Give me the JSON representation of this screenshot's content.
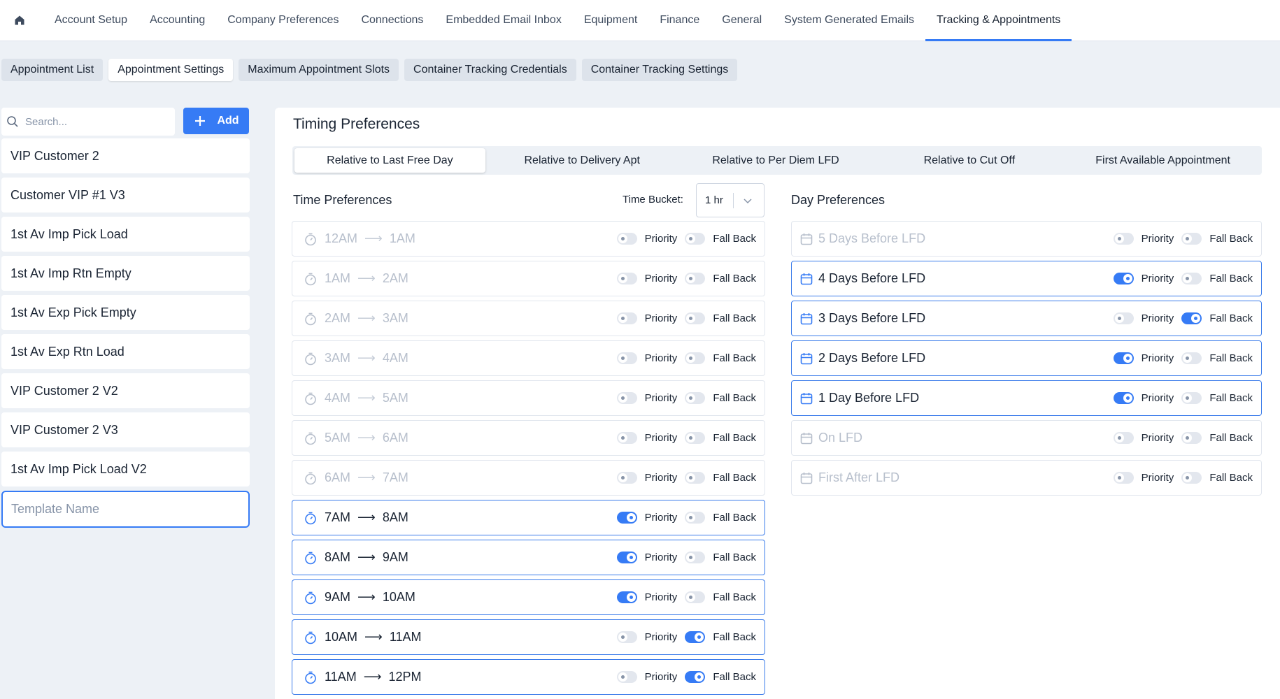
{
  "topnav": {
    "items": [
      {
        "label": "Account Setup"
      },
      {
        "label": "Accounting"
      },
      {
        "label": "Company Preferences"
      },
      {
        "label": "Connections"
      },
      {
        "label": "Embedded Email Inbox"
      },
      {
        "label": "Equipment"
      },
      {
        "label": "Finance"
      },
      {
        "label": "General"
      },
      {
        "label": "System Generated Emails"
      },
      {
        "label": "Tracking & Appointments"
      }
    ],
    "active_index": 9
  },
  "subtabs": {
    "items": [
      {
        "label": "Appointment List"
      },
      {
        "label": "Appointment Settings"
      },
      {
        "label": "Maximum Appointment Slots"
      },
      {
        "label": "Container Tracking Credentials"
      },
      {
        "label": "Container Tracking Settings"
      }
    ],
    "active_index": 1
  },
  "left": {
    "search_placeholder": "Search...",
    "add_label": "Add",
    "templates": [
      {
        "name": "VIP Customer 2"
      },
      {
        "name": "Customer VIP #1 V3"
      },
      {
        "name": "1st Av Imp Pick Load"
      },
      {
        "name": "1st Av Imp Rtn Empty"
      },
      {
        "name": "1st Av Exp Pick Empty"
      },
      {
        "name": "1st Av Exp Rtn Load"
      },
      {
        "name": "VIP Customer 2 V2"
      },
      {
        "name": "VIP Customer 2 V3"
      },
      {
        "name": "1st Av Imp Pick Load V2"
      }
    ],
    "template_name_placeholder": "Template Name"
  },
  "main": {
    "title": "Timing Preferences",
    "mode_tabs": [
      {
        "label": "Relative to Last Free Day"
      },
      {
        "label": "Relative to Delivery Apt"
      },
      {
        "label": "Relative to Per Diem LFD"
      },
      {
        "label": "Relative to Cut Off"
      },
      {
        "label": "First Available Appointment"
      }
    ],
    "active_mode_index": 0,
    "time_prefs": {
      "title": "Time Preferences",
      "bucket_label": "Time Bucket:",
      "bucket_value": "1 hr",
      "priority_label": "Priority",
      "fallback_label": "Fall Back",
      "rows": [
        {
          "from": "12AM",
          "to": "1AM",
          "priority": false,
          "fallback": false
        },
        {
          "from": "1AM",
          "to": "2AM",
          "priority": false,
          "fallback": false
        },
        {
          "from": "2AM",
          "to": "3AM",
          "priority": false,
          "fallback": false
        },
        {
          "from": "3AM",
          "to": "4AM",
          "priority": false,
          "fallback": false
        },
        {
          "from": "4AM",
          "to": "5AM",
          "priority": false,
          "fallback": false
        },
        {
          "from": "5AM",
          "to": "6AM",
          "priority": false,
          "fallback": false
        },
        {
          "from": "6AM",
          "to": "7AM",
          "priority": false,
          "fallback": false
        },
        {
          "from": "7AM",
          "to": "8AM",
          "priority": true,
          "fallback": false
        },
        {
          "from": "8AM",
          "to": "9AM",
          "priority": true,
          "fallback": false
        },
        {
          "from": "9AM",
          "to": "10AM",
          "priority": true,
          "fallback": false
        },
        {
          "from": "10AM",
          "to": "11AM",
          "priority": false,
          "fallback": true
        },
        {
          "from": "11AM",
          "to": "12PM",
          "priority": false,
          "fallback": true
        }
      ]
    },
    "day_prefs": {
      "title": "Day Preferences",
      "rows": [
        {
          "label": "5 Days Before LFD",
          "priority": false,
          "fallback": false
        },
        {
          "label": "4 Days Before LFD",
          "priority": true,
          "fallback": false
        },
        {
          "label": "3 Days Before LFD",
          "priority": false,
          "fallback": true
        },
        {
          "label": "2 Days Before LFD",
          "priority": true,
          "fallback": false
        },
        {
          "label": "1 Day Before LFD",
          "priority": true,
          "fallback": false
        },
        {
          "label": "On LFD",
          "priority": false,
          "fallback": false
        },
        {
          "label": "First After LFD",
          "priority": false,
          "fallback": false
        }
      ]
    }
  },
  "colors": {
    "accent": "#367bf5",
    "background": "#edf1f6",
    "muted_text": "#b7bfcc"
  }
}
